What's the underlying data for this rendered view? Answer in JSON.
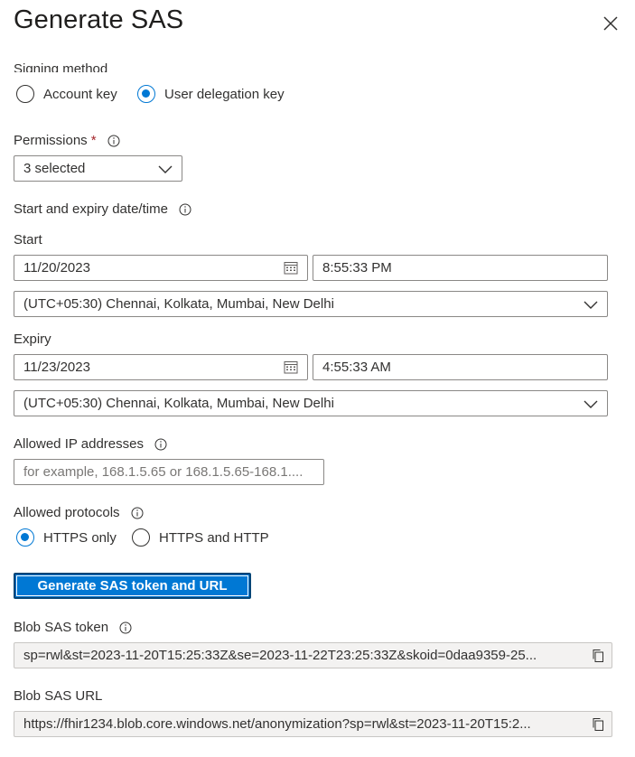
{
  "panel": {
    "title": "Generate SAS"
  },
  "signing": {
    "label": "Signing method",
    "options": [
      "Account key",
      "User delegation key"
    ],
    "selected": "User delegation key"
  },
  "permissions": {
    "label": "Permissions",
    "required_mark": "*",
    "value": "3 selected"
  },
  "dates": {
    "label": "Start and expiry date/time",
    "start": {
      "label": "Start",
      "date": "11/20/2023",
      "time": "8:55:33 PM",
      "timezone": "(UTC+05:30) Chennai, Kolkata, Mumbai, New Delhi"
    },
    "expiry": {
      "label": "Expiry",
      "date": "11/23/2023",
      "time": "4:55:33 AM",
      "timezone": "(UTC+05:30) Chennai, Kolkata, Mumbai, New Delhi"
    }
  },
  "ip": {
    "label": "Allowed IP addresses",
    "placeholder": "for example, 168.1.5.65 or 168.1.5.65-168.1...."
  },
  "protocols": {
    "label": "Allowed protocols",
    "options": [
      "HTTPS only",
      "HTTPS and HTTP"
    ],
    "selected": "HTTPS only"
  },
  "generate_button": "Generate SAS token and URL",
  "token": {
    "label": "Blob SAS token",
    "value": "sp=rwl&st=2023-11-20T15:25:33Z&se=2023-11-22T23:25:33Z&skoid=0daa9359-25..."
  },
  "url": {
    "label": "Blob SAS URL",
    "value": "https://fhir1234.blob.core.windows.net/anonymization?sp=rwl&st=2023-11-20T15:2..."
  },
  "colors": {
    "accent": "#0078d4",
    "required": "#a4262c",
    "border": "#8a8886",
    "readonly_bg": "#f3f2f1"
  }
}
